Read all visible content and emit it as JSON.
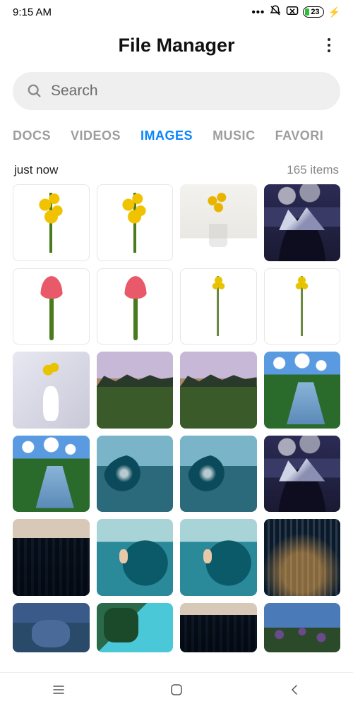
{
  "status": {
    "time": "9:15 AM",
    "battery_pct": "23"
  },
  "header": {
    "title": "File Manager"
  },
  "search": {
    "placeholder": "Search"
  },
  "tabs": {
    "items": [
      "DOCS",
      "VIDEOS",
      "IMAGES",
      "MUSIC",
      "FAVORI"
    ],
    "active_index": 2
  },
  "group": {
    "label": "just now",
    "count": "165 items"
  }
}
